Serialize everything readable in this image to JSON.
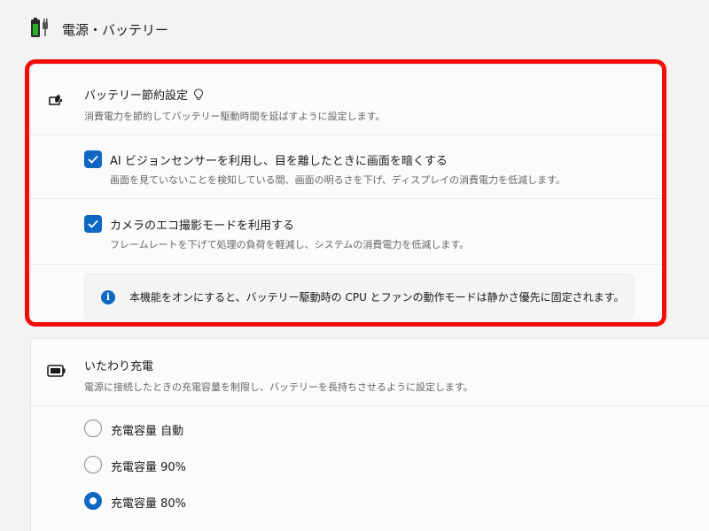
{
  "header": {
    "title": "電源・バッテリー"
  },
  "battery_saver": {
    "title": "バッテリー節約設定",
    "description": "消費電力を節約してバッテリー駆動時間を延ばすように設定します。",
    "options": [
      {
        "title": "AI ビジョンセンサーを利用し、目を離したときに画面を暗くする",
        "description": "画面を見ていないことを検知している間、画面の明るさを下げ、ディスプレイの消費電力を低減します。",
        "checked": true
      },
      {
        "title": "カメラのエコ撮影モードを利用する",
        "description": "フレームレートを下げて処理の負荷を軽減し、システムの消費電力を低減します。",
        "checked": true
      }
    ],
    "info": "本機能をオンにすると、バッテリー駆動時の CPU とファンの動作モードは静かさ優先に固定されます。"
  },
  "charge_care": {
    "title": "いたわり充電",
    "description": "電源に接続したときの充電容量を制限し、バッテリーを長持ちさせるように設定します。",
    "options": [
      {
        "label": "充電容量 自動",
        "selected": false
      },
      {
        "label": "充電容量 90%",
        "selected": false
      },
      {
        "label": "充電容量 80%",
        "selected": true
      }
    ]
  },
  "colors": {
    "accent": "#0f67c4",
    "highlight": "#f20d0d",
    "battery_green": "#27b02a"
  },
  "icons": {
    "header": "battery-plug-icon",
    "battery_saver": "battery-saver-icon",
    "battery_saver_tip": "lightbulb-icon",
    "charge_care": "battery-icon",
    "info": "info-icon"
  }
}
